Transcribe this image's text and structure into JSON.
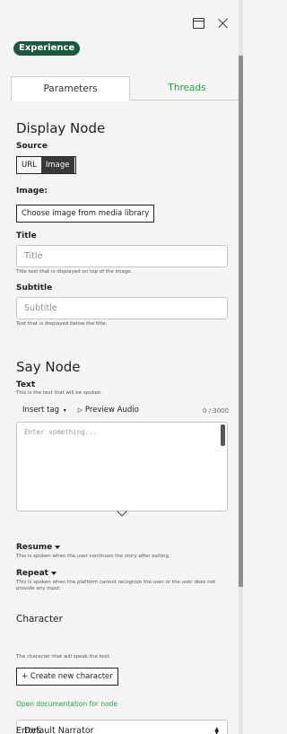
{
  "window": {
    "restore_icon": "restore-window-icon",
    "close_icon": "close-icon"
  },
  "badge": "Experience",
  "tabs": [
    {
      "label": "Parameters",
      "active": true
    },
    {
      "label": "Threads",
      "active": false
    }
  ],
  "display_node": {
    "title": "Display Node",
    "source_label": "Source",
    "source_options": [
      "URL",
      "Image"
    ],
    "source_selected": "Image",
    "image_label": "Image:",
    "choose_image_button": "Choose image from media library",
    "title_field": {
      "label": "Title",
      "placeholder": "Title",
      "helper": "Title text that is displayed on top of the image."
    },
    "subtitle_field": {
      "label": "Subtitle",
      "placeholder": "Subtitle",
      "helper": "Text that is displayed below the title."
    }
  },
  "say_node": {
    "title": "Say Node",
    "text_label": "Text",
    "text_helper": "This is the text that will be spoken.",
    "insert_tag": "Insert tag",
    "preview_audio": "Preview Audio",
    "char_count": "0 / 3000",
    "textarea_placeholder": "Enter something...",
    "resume_label": "Resume",
    "resume_helper": "This is spoken when the user continues the story after exiting.",
    "repeat_label": "Repeat",
    "repeat_helper": "This is spoken when the platform cannot recognize the user or the user does not provide any input."
  },
  "character": {
    "title": "Character",
    "selected": "Default Narrator",
    "helper": "The character that will speak the text.",
    "create_button": "Create new character"
  },
  "doc_link": "Open documentation for node",
  "errors_title": "Errors",
  "colors": {
    "badge_bg": "#175a3d",
    "accent_green": "#24a148",
    "selected_segment": "#393939"
  }
}
